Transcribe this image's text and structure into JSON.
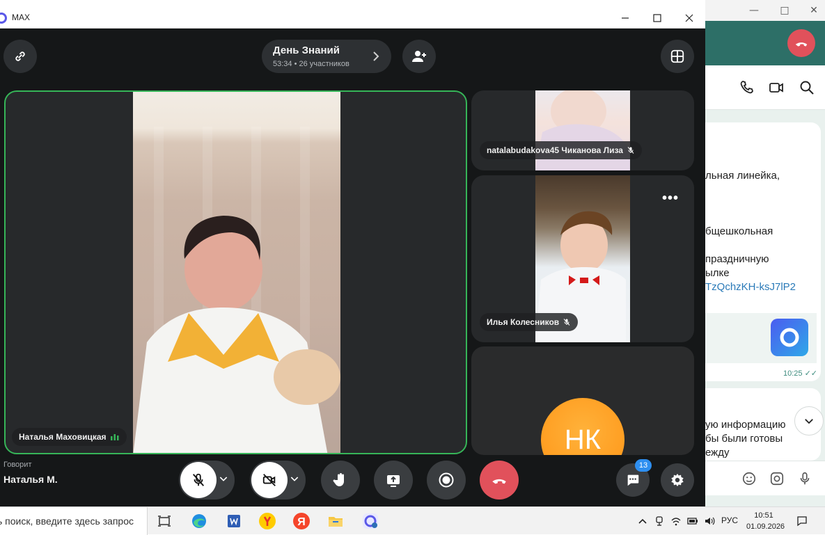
{
  "app": {
    "title": "MAX"
  },
  "call": {
    "title": "День Знаний",
    "duration": "53:34",
    "participants": "26 участников"
  },
  "main_speaker": {
    "name": "Наталья Маховицкая"
  },
  "participants": [
    {
      "name": "natalabudakova45 Чиканова Лиза"
    },
    {
      "name": "Илья Колесников"
    },
    {
      "initials": "НК"
    }
  ],
  "speaking": {
    "label": "Говорит",
    "name": "Наталья М."
  },
  "chat": {
    "unread": "13"
  },
  "background_chat": {
    "lines": [
      "льная линейка,",
      "бщешкольная",
      "праздничную",
      "ылке",
      "TzQchzKH-ksJ7lP2"
    ],
    "time": "10:25",
    "lines2": [
      "ую информацию",
      "бы были готовы",
      "ежду"
    ]
  },
  "taskbar": {
    "search_text": "ь поиск, введите здесь запрос",
    "language": "РУС",
    "time": "10:51",
    "date": "01.09.2026"
  },
  "colors": {
    "active_speaker_border": "#36b558",
    "end_call": "#e1515b",
    "avatar_orange": "#ff9e20",
    "badge_blue": "#2e8ff0"
  }
}
